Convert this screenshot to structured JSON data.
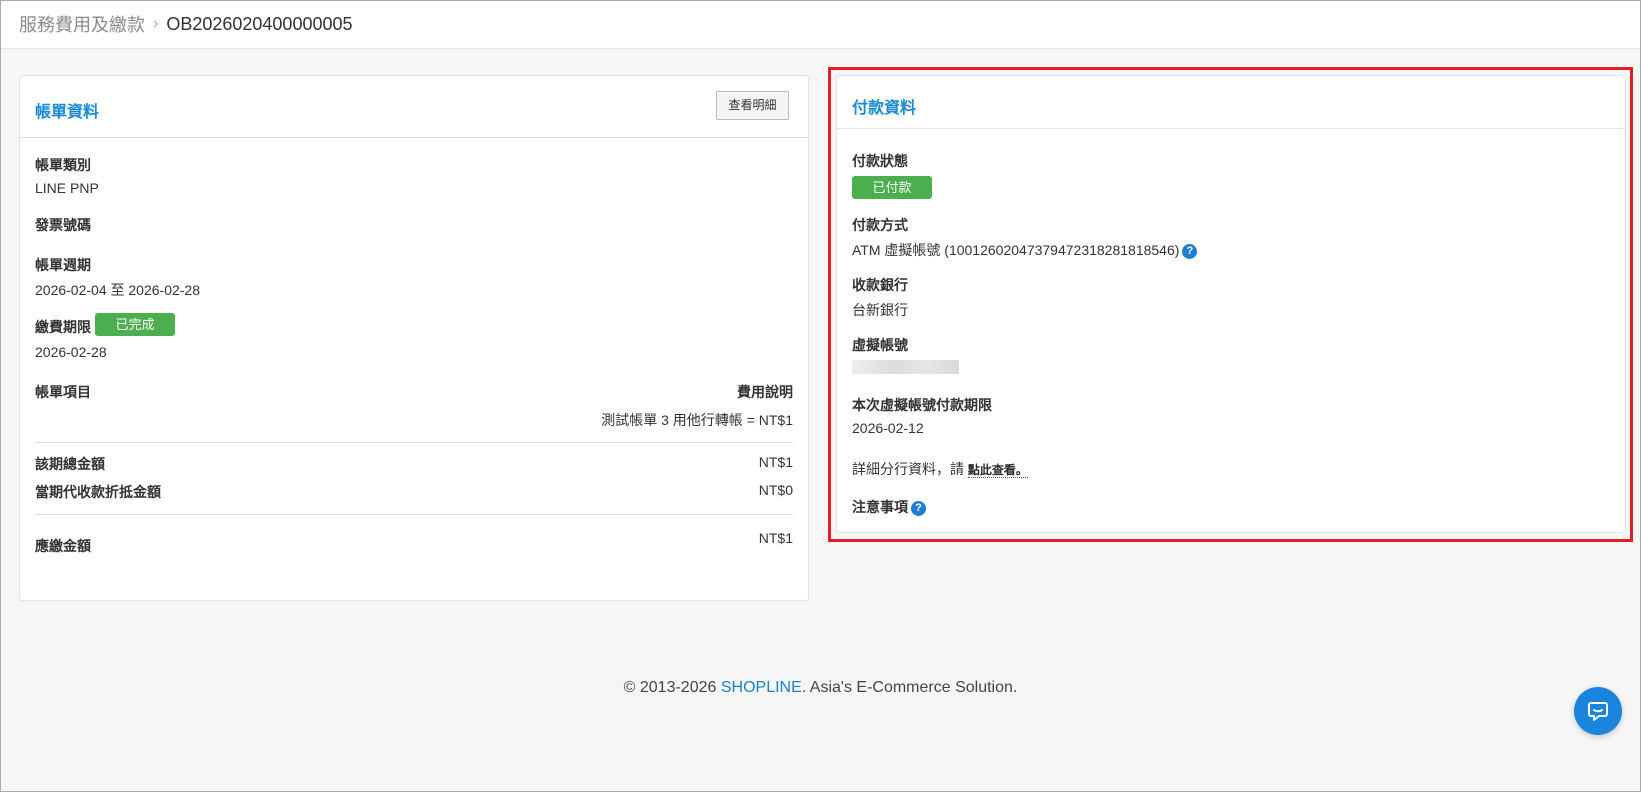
{
  "breadcrumb": {
    "parent": "服務費用及繳款",
    "separator": "›",
    "current": "OB2026020400000005"
  },
  "bill_panel": {
    "title": "帳單資料",
    "detail_button": "查看明細",
    "bill_type_label": "帳單類別",
    "bill_type_value": "LINE PNP",
    "invoice_label": "發票號碼",
    "period_label": "帳單週期",
    "period_value": "2026-02-04 至 2026-02-28",
    "due_label": "繳費期限",
    "due_badge": "已完成",
    "due_value": "2026-02-28",
    "items_label": "帳單項目",
    "fee_desc_label": "費用說明",
    "item_line": "測試帳單 3 用他行轉帳 = NT$1",
    "total_label": "該期總金額",
    "total_value": "NT$1",
    "offset_label": "當期代收款折抵金額",
    "offset_value": "NT$0",
    "payable_label": "應繳金額",
    "payable_value": "NT$1"
  },
  "payment_panel": {
    "title": "付款資料",
    "status_label": "付款狀態",
    "status_badge": "已付款",
    "method_label": "付款方式",
    "method_value": "ATM 虛擬帳號 (10012602047379472318281818546)",
    "bank_label": "收款銀行",
    "bank_value": "台新銀行",
    "virtual_label": "虛擬帳號",
    "deadline_label": "本次虛擬帳號付款期限",
    "deadline_value": "2026-02-12",
    "branch_text": "詳細分行資料，請",
    "branch_link": "點此查看。",
    "notes_label": "注意事項"
  },
  "footer": {
    "prefix": "© 2013-2026 ",
    "brand": "SHOPLINE",
    "suffix": ". Asia's E-Commerce Solution."
  },
  "colors": {
    "accent": "#1b8bd6",
    "success": "#4cae4f",
    "highlight": "#e41e26"
  },
  "icons": {
    "help": "question-circle-icon",
    "chat": "chat-bubble-icon"
  }
}
